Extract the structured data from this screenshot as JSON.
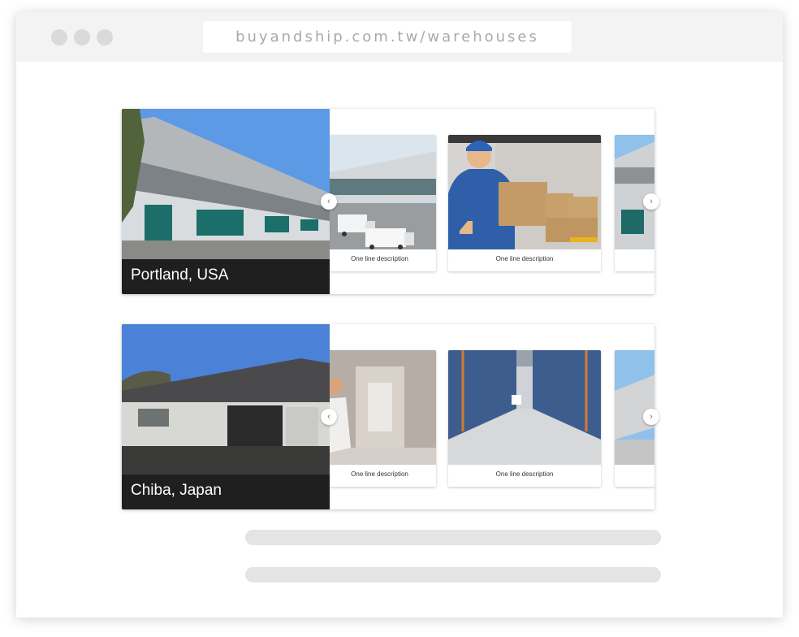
{
  "browser": {
    "url": "buyandship.com.tw/warehouses"
  },
  "warehouses": [
    {
      "location": "Portland, USA",
      "photos": [
        {
          "description": "One line description"
        },
        {
          "description": "One line description"
        },
        {
          "description": ""
        }
      ]
    },
    {
      "location": "Chiba, Japan",
      "photos": [
        {
          "description": "One line description"
        },
        {
          "description": "One line description"
        },
        {
          "description": ""
        }
      ]
    }
  ],
  "icons": {
    "prev": "chevron-left-icon",
    "next": "chevron-right-icon",
    "prev_glyph": "‹",
    "next_glyph": "›"
  },
  "colors": {
    "label_bg": "#1f1f1f",
    "skeleton": "#e4e4e4"
  }
}
